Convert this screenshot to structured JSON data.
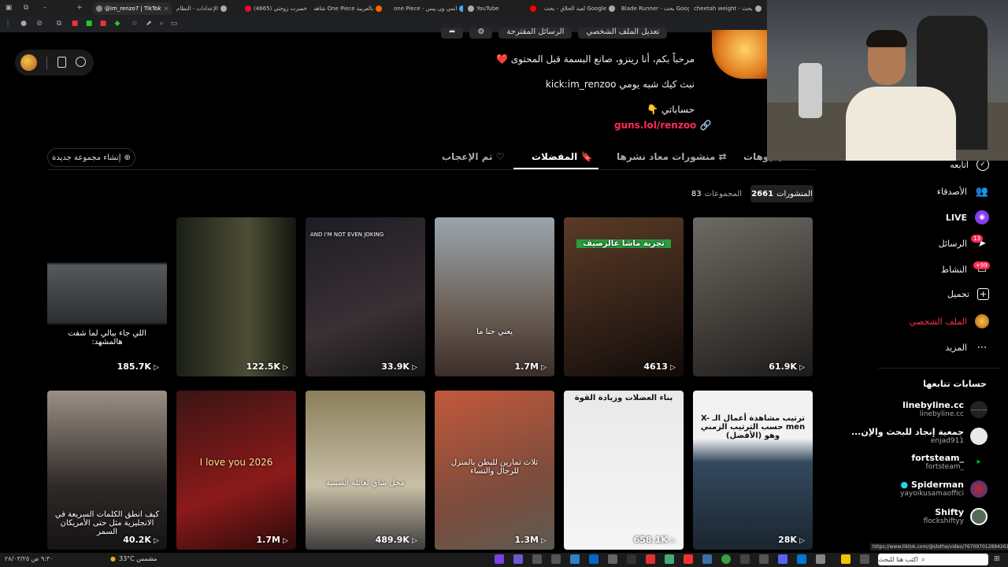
{
  "browser": {
    "tabs": [
      {
        "label": "",
        "color": "#888"
      },
      {
        "label": "@im_renzo7 | TikTok",
        "color": "#fff",
        "active": true
      },
      {
        "label": "الإعدادات - النظام",
        "color": "#aaa"
      },
      {
        "label": "(4665) خسرت زوجتي",
        "color": "#f03"
      },
      {
        "label": "شاهد One Piece بالعربية",
        "color": "#f60"
      },
      {
        "label": "one Piece - انمي ون بيس",
        "color": "#4af"
      },
      {
        "label": "YouTube",
        "color": "#f00"
      },
      {
        "label": "لعبة الحلاق - بحث Google",
        "color": "#aaa"
      },
      {
        "label": "Blade Runner - بحث Google",
        "color": "#aaa"
      },
      {
        "label": "cheetah weight - بحث",
        "color": "#aaa"
      }
    ]
  },
  "profile": {
    "buttons": [
      "الرسائل المقترحة",
      "تعديل الملف الشخصي"
    ],
    "bio_line1": "مرحباً بكم، أنا رينزو، صانع البسمة قبل المحتوى ❤️",
    "bio_line2": "نبث كيك شبه يومي kick:im_renzoo",
    "bio_line3": "حساباتي 👇",
    "link": "guns.lol/renzoo 🔗"
  },
  "profile_tabs": {
    "videos": "الفيديوهات",
    "reposts": "منشورات معاد نشرها",
    "favorites": "المفضلات",
    "liked": "تم الإعجاب",
    "new_collection": "إنشاء مجموعة جديدة"
  },
  "counts": {
    "posts_label": "المنشورات",
    "posts_value": "2661",
    "collections_label": "المجموعات",
    "collections_value": "83"
  },
  "grid": [
    {
      "views": "61.9K",
      "caption": "",
      "bg": "linear-gradient(160deg,#6d6a66,#3f3a36 60%,#1c1b1a)"
    },
    {
      "views": "4613",
      "caption": "تجربة ماشا عالرصيف",
      "bg": "linear-gradient(160deg,#5a3b26,#2a1b14 70%,#100a07)"
    },
    {
      "views": "1.7M",
      "caption": "يعني حنا ما",
      "bg": "linear-gradient(180deg,#9aa5ad,#6b5e54 60%,#3b2e29)"
    },
    {
      "views": "33.9K",
      "caption": "AND I'M NOT EVEN JOKING",
      "bg": "linear-gradient(160deg,#1d1d24,#3a3035 60%,#141414)"
    },
    {
      "views": "122.5K",
      "caption": "",
      "bg": "linear-gradient(90deg,#1a1e15,#4d4e35 60%,#141610)"
    },
    {
      "views": "185.7K",
      "caption": "اللي جاء ببالي لما شفت هالمشهد:",
      "bg": "linear-gradient(180deg,#000 0%,#000 28%,#55595c 30%,#2d2f31 66%,#000 68%)"
    },
    {
      "views": "28K",
      "caption": "ترتيب مشاهدة أعمال الـ X-men حسب الترتيب الزمني وهو (الأفضل)",
      "bg": "linear-gradient(180deg,#f2f2f2 0%,#f2f2f2 30%,#34495e 45%,#1a252f 100%)"
    },
    {
      "views": "658.1K",
      "caption": "بناء العضلات وزيادة القوة",
      "bg": "linear-gradient(180deg,#e9e9e9,#f5f5f5)"
    },
    {
      "views": "1.3M",
      "caption": "ثلاث تمارين للبطن بالمنزل للرجال والنساء",
      "bg": "linear-gradient(160deg,#c2593c,#7e4c3c 60%,#5d5a52)"
    },
    {
      "views": "489.9K",
      "caption": "محل شاي لعائلة الصينية",
      "bg": "linear-gradient(180deg,#8a7e5a,#c9bfa6 60%,#3c3c3c)"
    },
    {
      "views": "1.7M",
      "caption": "2026 I love you",
      "bg": "linear-gradient(160deg,#3b1414,#8b1a1a 60%,#2a0a0a)"
    },
    {
      "views": "40.2K",
      "caption": "كيف انطق الكلمات السريعة في الانجليزية مثل حتى الأمريكان السمر",
      "bg": "linear-gradient(180deg,#9b8f85,#2f2a28 60%,#151313)"
    }
  ],
  "sidebar": {
    "nav": [
      {
        "label": "أتابعه",
        "icon": "following-icon"
      },
      {
        "label": "الأصدقاء",
        "icon": "friends-icon"
      },
      {
        "label": "LIVE",
        "icon": "live-icon"
      },
      {
        "label": "الرسائل",
        "icon": "messages-icon",
        "badge": "13"
      },
      {
        "label": "النشاط",
        "icon": "activity-icon",
        "badge": "+99"
      },
      {
        "label": "تحميل",
        "icon": "upload-icon"
      },
      {
        "label": "الملف الشخصي",
        "icon": "profile-icon"
      },
      {
        "label": "المزيد",
        "icon": "more-icon"
      }
    ],
    "following_title": "حسابات تتابعها",
    "following": [
      {
        "name": "linebyline.cc",
        "handle": "linebyline.cc",
        "color": "#222"
      },
      {
        "name": "جمعية إنجاد للبحث والإن...",
        "handle": "enjad911",
        "color": "#e9e9e9"
      },
      {
        "name": "_fortsteam",
        "handle": "_fortsteam",
        "color": "#0b3"
      },
      {
        "name": "Spiderman",
        "handle": "yayoikusamaoffici",
        "color": "#c1272d",
        "verified": true
      },
      {
        "name": "Shifty",
        "handle": "flockshiftyy",
        "color": "#556b5a"
      }
    ]
  },
  "taskbar": {
    "weather": "33°C مشمس",
    "search": "اكتب هنا للبحث",
    "time": "٩:٣٠ ص",
    "date": "٢٨/٠٣/٢٥"
  },
  "status_url": "https://www.tiktok.com/@slothe/video/7670970128942615816"
}
